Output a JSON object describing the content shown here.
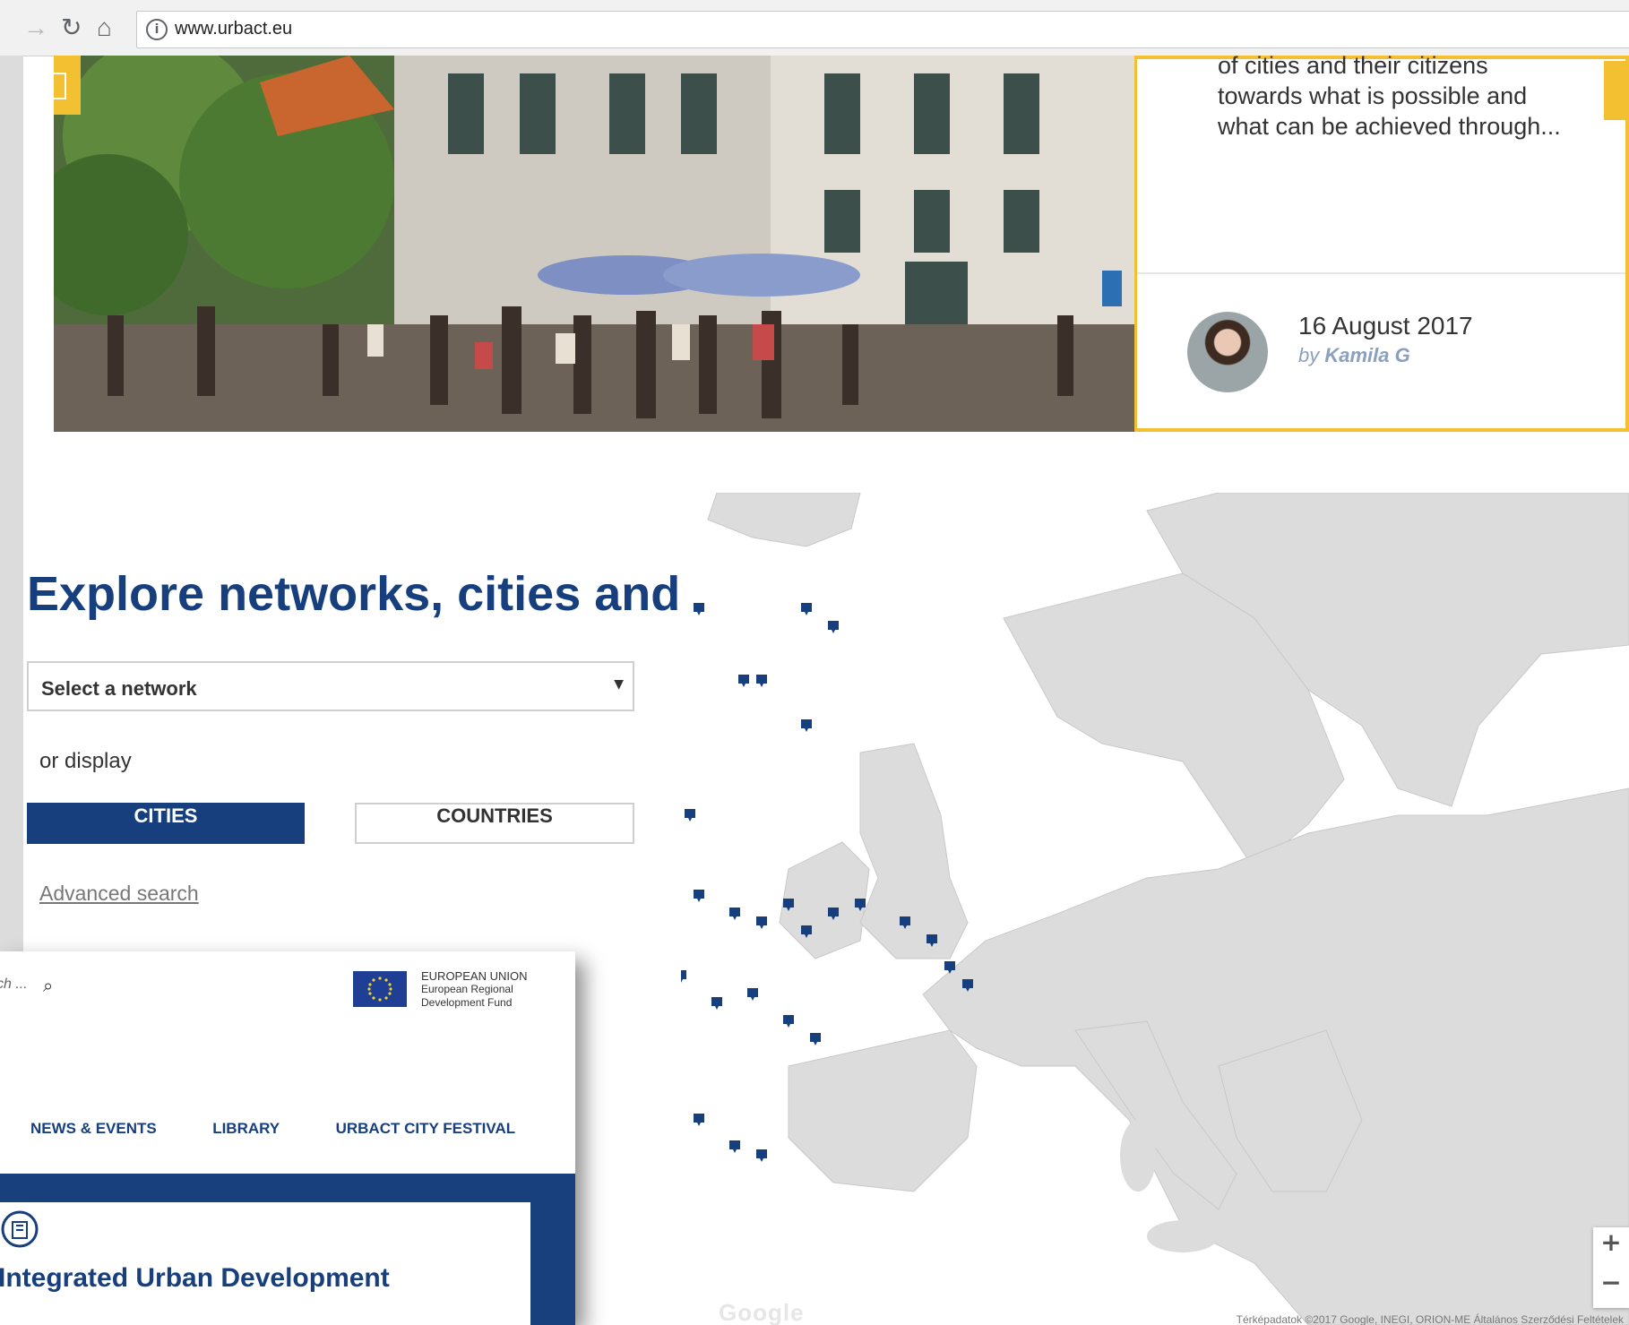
{
  "browser": {
    "url": "www.urbact.eu",
    "icons": [
      "back-arrow-icon",
      "reload-icon",
      "home-icon",
      "info-icon"
    ]
  },
  "hero_card": {
    "excerpt_lines": [
      "of cities and their citizens",
      "towards what is possible and",
      "what can be achieved through..."
    ],
    "date": "16 August 2017",
    "author_prefix": "by",
    "author_name": "Kamila G"
  },
  "explore": {
    "title": "Explore networks, cities and countries",
    "network_select": {
      "selected": "Select a network"
    },
    "or_display": "or display",
    "toggle": {
      "cities": "CITIES",
      "countries": "COUNTRIES",
      "active": "cities"
    },
    "advanced_search": "Advanced search"
  },
  "map": {
    "watermark": "Google",
    "attribution": "Térképadatok ©2017 Google, INEGI, ORION-ME    Általános Szerződési Feltételek",
    "zoom_in": "+",
    "zoom_out": "−",
    "marker_color": "#173f7e"
  },
  "overlay": {
    "search_placeholder": "ch ...",
    "eu_lines": [
      "EUROPEAN UNION",
      "European Regional",
      "Development Fund"
    ],
    "nav": [
      "NEWS & EVENTS",
      "LIBRARY",
      "URBACT CITY FESTIVAL"
    ],
    "card_title": "Integrated Urban Development"
  },
  "colors": {
    "brand_blue": "#173f7e",
    "accent_yellow": "#f2c030"
  }
}
